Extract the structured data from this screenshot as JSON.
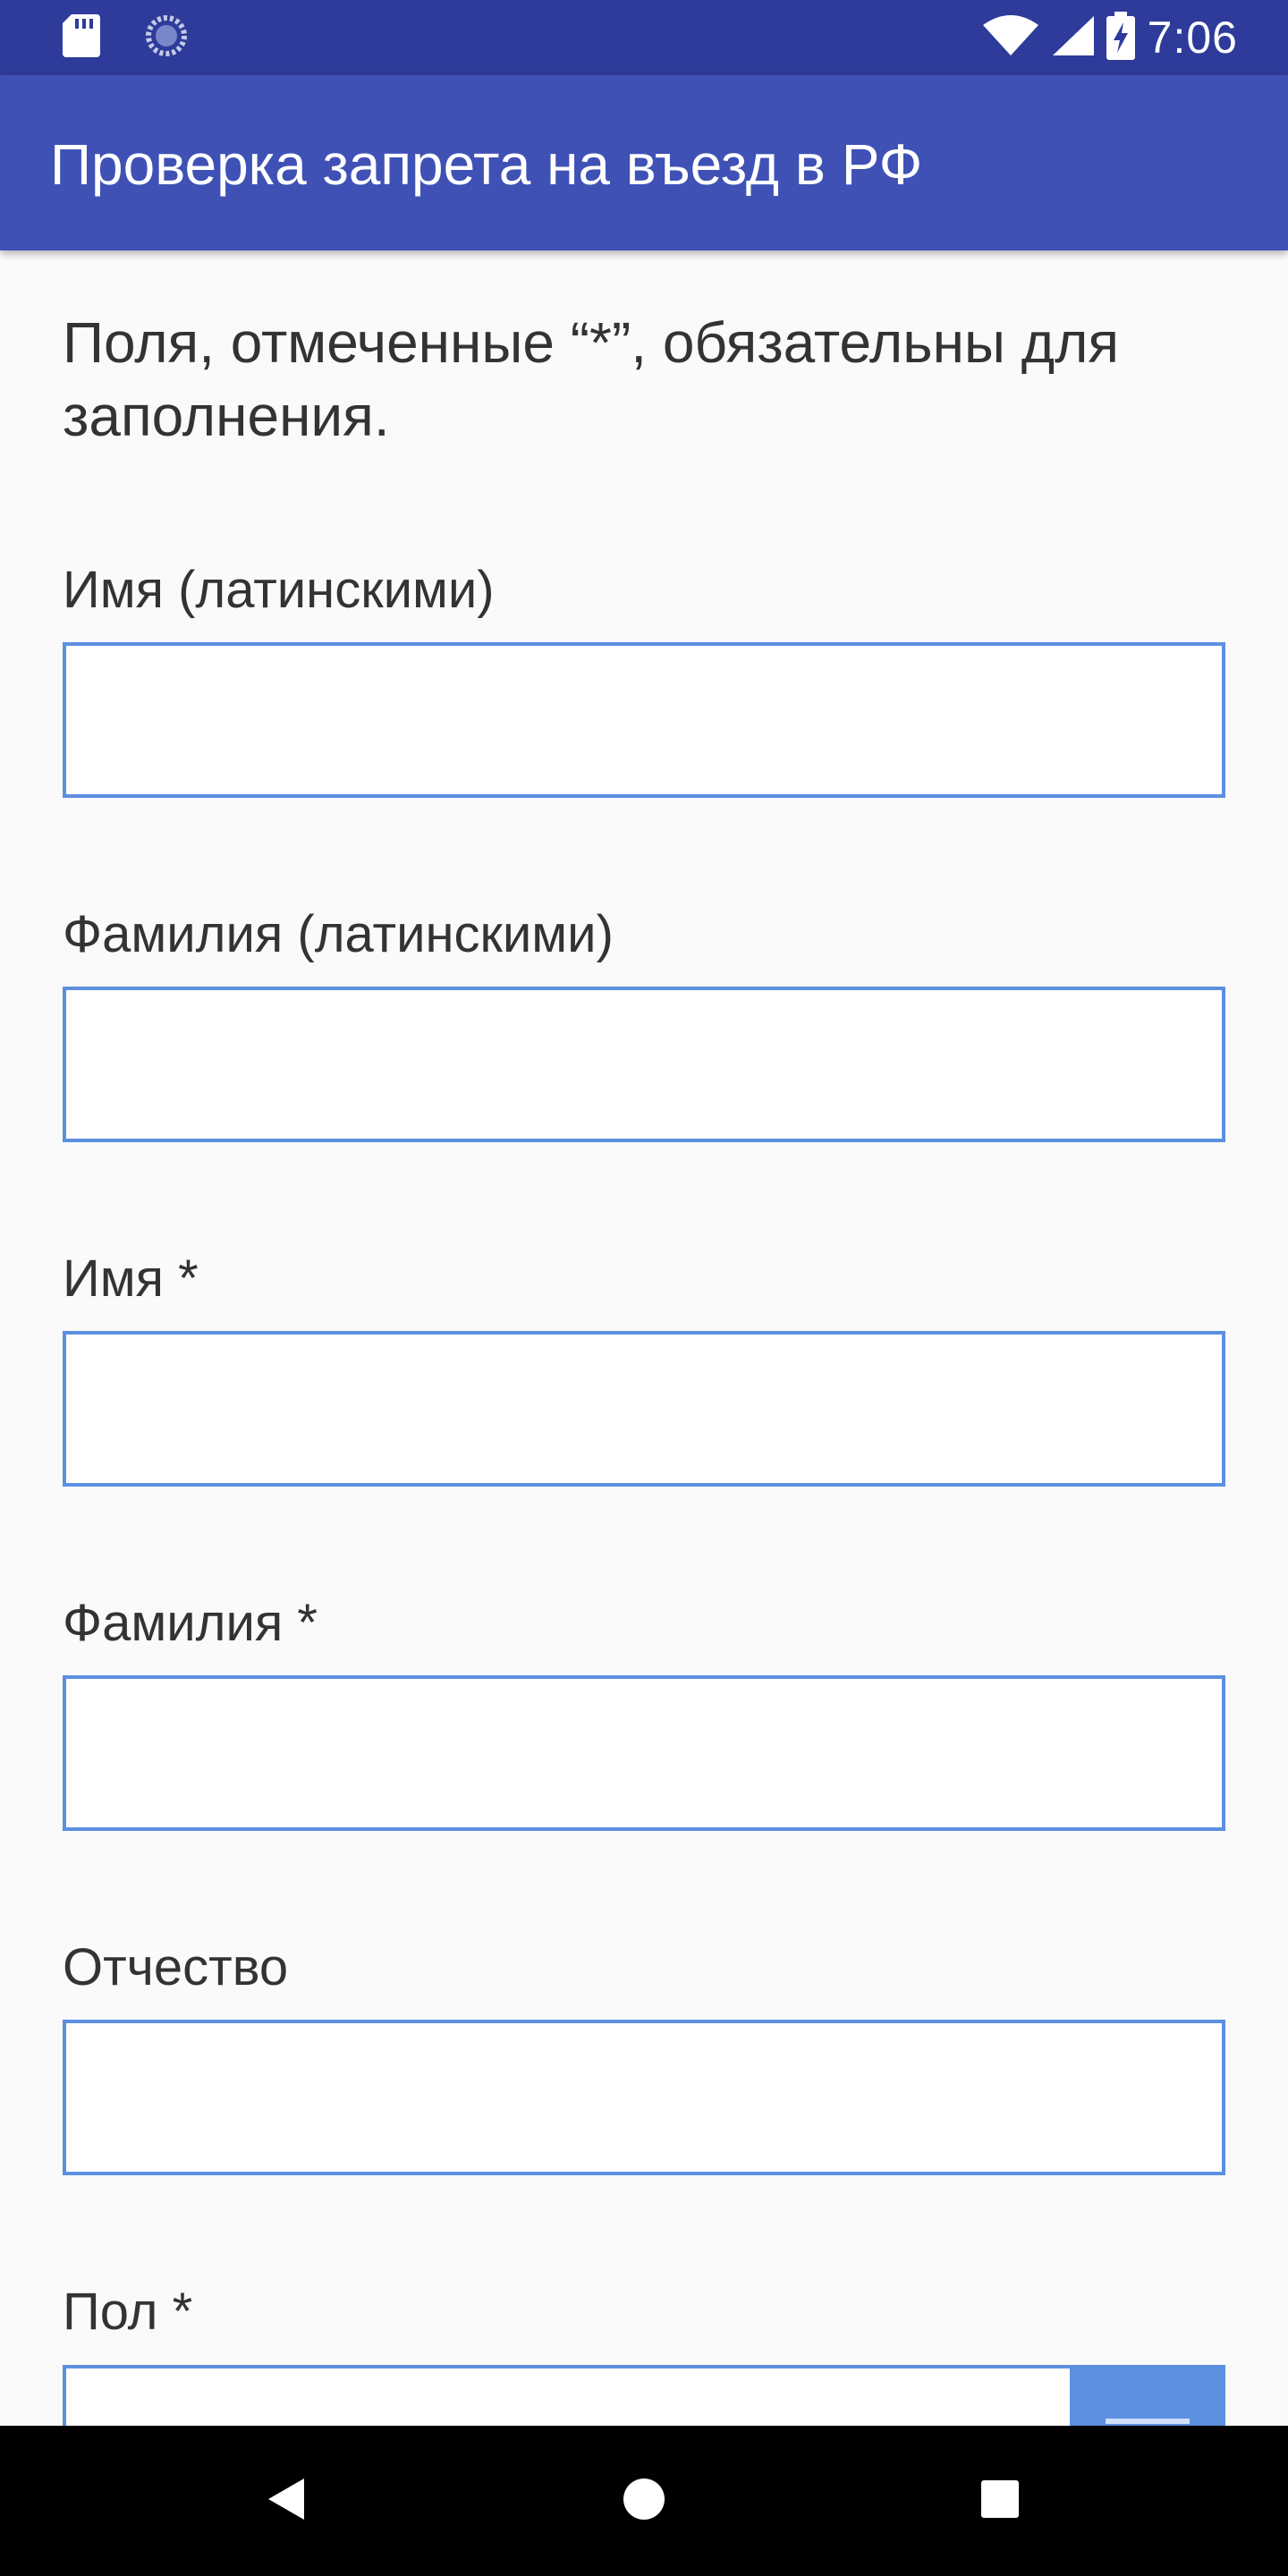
{
  "status_bar": {
    "time": "7:06",
    "icons": [
      "sd-card-icon",
      "sync-icon",
      "wifi-icon",
      "signal-icon",
      "battery-charging-icon"
    ]
  },
  "app_bar": {
    "title": "Проверка запрета на въезд в РФ"
  },
  "form": {
    "intro": "Поля, отмеченные “*”, обязательны для заполнения.",
    "fields": [
      {
        "label": "Имя (латинскими)",
        "value": "",
        "placeholder": ""
      },
      {
        "label": "Фамилия (латинскими)",
        "value": "",
        "placeholder": ""
      },
      {
        "label": "Имя *",
        "value": "",
        "placeholder": ""
      },
      {
        "label": "Фамилия *",
        "value": "",
        "placeholder": ""
      },
      {
        "label": "Отчество",
        "value": "",
        "placeholder": ""
      }
    ],
    "gender": {
      "label": "Пол *",
      "value": ""
    }
  },
  "nav_bar": {
    "buttons": [
      "back-icon",
      "home-icon",
      "recents-icon"
    ]
  },
  "colors": {
    "status_bar": "#2e3b9a",
    "app_bar": "#3f51b5",
    "input_border": "#5c8fe0",
    "background": "#fafafa",
    "text": "#333333"
  }
}
